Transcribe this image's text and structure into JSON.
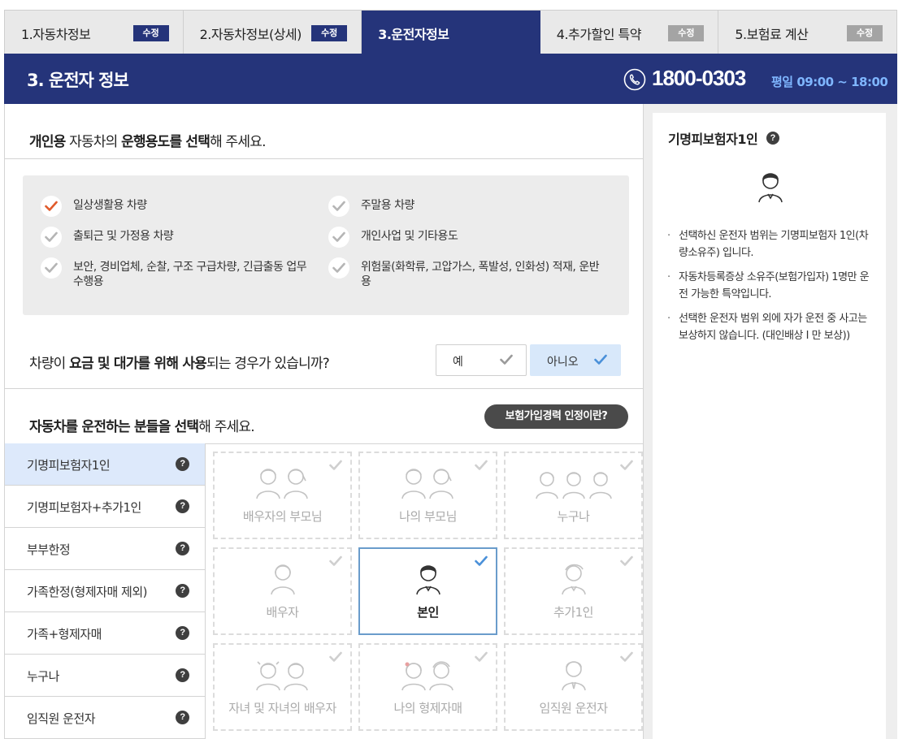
{
  "tabs": [
    {
      "label": "1.자동차정보",
      "badge": "수정",
      "state": "done"
    },
    {
      "label": "2.자동차정보(상세)",
      "badge": "수정",
      "state": "done"
    },
    {
      "label": "3.운전자정보",
      "badge": "",
      "state": "active"
    },
    {
      "label": "4.추가할인 특약",
      "badge": "수정",
      "state": "pending"
    },
    {
      "label": "5.보험료 계산",
      "badge": "수정",
      "state": "pending"
    }
  ],
  "header": {
    "title": "3. 운전자 정보",
    "phone": "1800-0303",
    "hours": "평일 09:00 ~ 18:00"
  },
  "usage": {
    "title_parts": [
      "개인용",
      " 자동차의 ",
      "운행용도를 선택",
      "해 주세요."
    ],
    "items": [
      {
        "label": "일상생활용 차량",
        "selected": true
      },
      {
        "label": "주말용 차량",
        "selected": false
      },
      {
        "label": "출퇴근 및 가정용 차량",
        "selected": false
      },
      {
        "label": "개인사업 및 기타용도",
        "selected": false
      },
      {
        "label": "보안, 경비업체, 순찰, 구조 구급차량, 긴급출동 업무수행용",
        "selected": false
      },
      {
        "label": "위험물(화학류, 고압가스, 폭발성, 인화성) 적재, 운반용",
        "selected": false
      }
    ]
  },
  "fee_question": {
    "parts": [
      "차량이 ",
      "요금 및 대가를 위해 사용",
      "되는 경우가 있습니까?"
    ],
    "yes": "예",
    "no": "아니오",
    "selected": "no"
  },
  "drivers": {
    "title_parts": [
      "자동차를 운전하는 분들을 선택",
      "해 주세요."
    ],
    "history_button": "보험가입경력 인정이란?",
    "ranges": [
      {
        "label": "기명피보험자1인",
        "active": true
      },
      {
        "label": "기명피보험자+추가1인",
        "active": false
      },
      {
        "label": "부부한정",
        "active": false
      },
      {
        "label": "가족한정(형제자매 제외)",
        "active": false
      },
      {
        "label": "가족+형제자매",
        "active": false
      },
      {
        "label": "누구나",
        "active": false
      },
      {
        "label": "임직원 운전자",
        "active": false
      }
    ],
    "help_glyph": "?",
    "cards": [
      {
        "label": "배우자의 부모님",
        "selected": false
      },
      {
        "label": "나의 부모님",
        "selected": false
      },
      {
        "label": "누구나",
        "selected": false
      },
      {
        "label": "배우자",
        "selected": false
      },
      {
        "label": "본인",
        "selected": true
      },
      {
        "label": "추가1인",
        "selected": false
      },
      {
        "label": "자녀 및 자녀의 배우자",
        "selected": false
      },
      {
        "label": "나의 형제자매",
        "selected": false
      },
      {
        "label": "임직원 운전자",
        "selected": false
      }
    ]
  },
  "side": {
    "title": "기명피보험자1인",
    "notes": [
      "선택하신 운전자 범위는 기명피보험자 1인(차량소유주) 입니다.",
      "자동차등록증상 소유주(보험가입자) 1명만 운전 가능한 특약입니다.",
      "선택한 운전자 범위 외에 자가 운전 중 사고는 보상하지 않습니다. (대인배상 I 만 보상))"
    ]
  },
  "colors": {
    "navy": "#25347a",
    "check_selected": "#e05a2b",
    "check_blue": "#4a90d9",
    "hours": "#7fb6ff"
  }
}
